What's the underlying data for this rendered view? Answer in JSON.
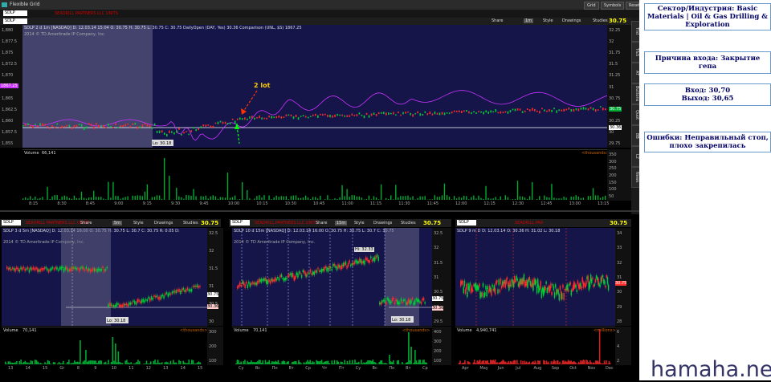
{
  "window": {
    "title": "Flexible Grid",
    "buttons": [
      "Grid",
      "Symbols",
      "Reset"
    ]
  },
  "grid_header": {
    "symbol": "SDLP",
    "company": "SEADRILL PARTNERS LLC UNITS"
  },
  "main_chart": {
    "symbol": "SDLP",
    "price": "30.75",
    "info": "SDLP 2 d 1m [NASDAQ]  D: 12.03.14 15:04  O: 30.75  H: 30.75  L: 30.75  C: 30.75  DailyOpen (DAY, Yes)  30.36  Comparison (UNL, $S)  1867.25",
    "watermark": "2014 © TD Ameritrade IP Company, Inc.",
    "toolbar": {
      "share": "Share",
      "period": "1m",
      "style": "Style",
      "drawings": "Drawings",
      "studies": "Studies"
    },
    "left_axis": [
      "1,880",
      "1,877.5",
      "1,875",
      "1,872.5",
      "1,870",
      "1,867.5",
      "1,865",
      "1,862.5",
      "1,860",
      "1,857.5",
      "1,855"
    ],
    "left_tag": "1867.25",
    "right_axis": [
      "32.25",
      "32",
      "31.75",
      "31.5",
      "31.25",
      "31",
      "30.75",
      "30.5",
      "30.25",
      "30",
      "29.75"
    ],
    "tag_last": "30.75",
    "tag_open": "30.36",
    "lo_label": "Lo: 30.18",
    "annotation_top": "2 lot",
    "annotation_bottom": "2 lot",
    "volume_label": "Volume",
    "volume_value": "66,141",
    "volume_unit": "<thousands>",
    "volume_axis": [
      "350",
      "300",
      "250",
      "200",
      "150",
      "100",
      "50"
    ],
    "time_axis": [
      "8:15",
      "8:30",
      "8:45",
      "9:00",
      "9:15",
      "9:30",
      "9:45",
      "10:00",
      "10:15",
      "10:30",
      "10:45",
      "11:00",
      "11:15",
      "11:30",
      "11:45",
      "12:00",
      "12:15",
      "12:30",
      "12:45",
      "13:00",
      "13:15"
    ],
    "side_tabs": [
      "Tlid",
      "T&S",
      "AT",
      "Buttons",
      "Quot",
      "BB",
      "L2",
      "News"
    ]
  },
  "chart_5m": {
    "symbol": "SDLP",
    "price": "30.75",
    "period": "5m",
    "info": "SDLP 3 d 5m [NASDAQ]  D: 12.03.14 16:00  O: 30.75  H: 30.75  L: 30.7  C: 30.75  R: 0.05  D:",
    "watermark": "2014 © TD Ameritrade IP Company, Inc.",
    "right_axis": [
      "32.5",
      "32",
      "31.5",
      "31",
      "30.5",
      "30"
    ],
    "tag_last": "30.75",
    "tag_open": "30.36",
    "lo_label": "Lo: 30.18",
    "volume_label": "Volume",
    "volume_value": "70,141",
    "volume_unit": "<thousands>",
    "volume_axis": [
      "300",
      "200",
      "100"
    ],
    "time_axis": [
      "13",
      "14",
      "15",
      "Gr",
      "8",
      "9",
      "10",
      "11",
      "12",
      "13",
      "14",
      "15"
    ]
  },
  "chart_15m": {
    "symbol": "SDLP",
    "price": "30.75",
    "period": "15m",
    "info": "SDLP 10 d 15m [NASDAQ]  D: 12.03.14 16:00  O: 30.75  H: 30.75  L: 30.7  C: 30.75",
    "watermark": "2014 © TD Ameritrade IP Company, Inc.",
    "right_axis": [
      "32.5",
      "32",
      "31.5",
      "31",
      "30.5",
      "30",
      "29.5"
    ],
    "tag_last": "30.75",
    "tag_open": "30.36",
    "hi_label": "Hi: 32.33",
    "lo_label": "Lo: 30.18",
    "volume_label": "Volume",
    "volume_value": "70,141",
    "volume_unit": "<thousands>",
    "volume_axis": [
      "400",
      "300",
      "200",
      "100"
    ],
    "time_axis": [
      "Cy",
      "Bc",
      "Пн",
      "Вт",
      "Ср",
      "Чт",
      "Пт",
      "Cy",
      "Bc",
      "Пн",
      "Вт",
      "Ср"
    ]
  },
  "chart_daily": {
    "symbol": "SDLP",
    "price": "30.75",
    "company": "SEADRILL PAR",
    "info": "SDLP 9 m D  D: 12.03.14  O: 30.36  H: 31.02  L: 30.18",
    "right_axis": [
      "34",
      "33",
      "32",
      "31",
      "30",
      "29",
      "28"
    ],
    "tag_last": "30.75",
    "volume_label": "Volume",
    "volume_value": "4,940,741",
    "volume_unit": "<millions>",
    "volume_axis": [
      "6",
      "4",
      "2"
    ],
    "time_axis": [
      "Apr",
      "May",
      "Jun",
      "Jul",
      "Aug",
      "Sep",
      "Oct",
      "Nov",
      "Dec"
    ]
  },
  "notes": {
    "sector": "Сектор/Индустрия: Basic Materials | Oil & Gas Drilling & Exploration",
    "reason": "Причина входа: Закрытие гепа",
    "entry": "Вход: 30,70",
    "exit": "Выход: 30,65",
    "errors": "Ошибки: Неправильный стоп, плохо закрепилась"
  },
  "watermark_site": "hamaha.net",
  "colors": {
    "chart_bg": "#15154a",
    "up_candle": "#00cc33",
    "down_candle": "#ff2a2a",
    "comparison_line": "#cc33ff",
    "open_line": "#ffffff",
    "annotation_green": "#00ff00",
    "annotation_red": "#ff3300",
    "note_text": "#000066"
  }
}
